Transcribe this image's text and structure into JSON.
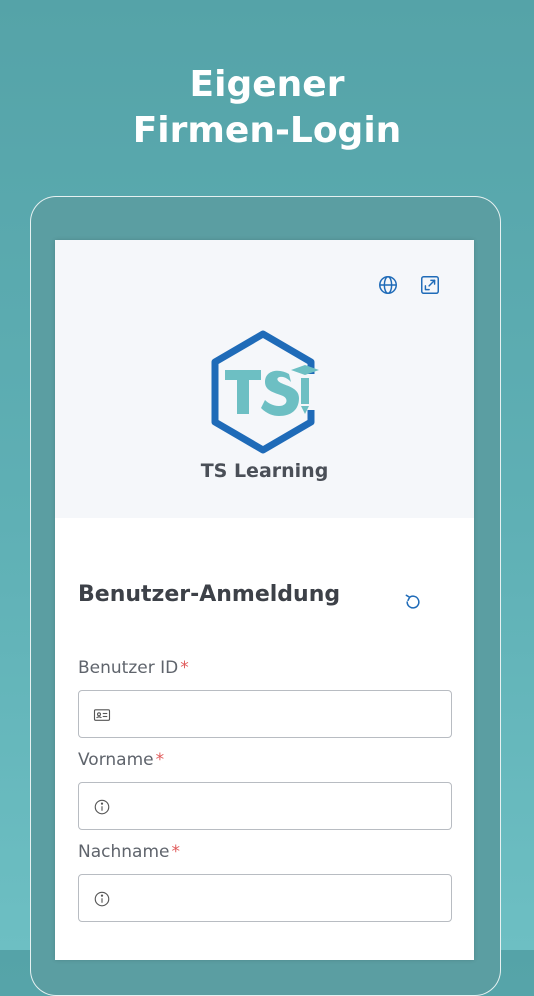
{
  "headline": {
    "line1": "Eigener",
    "line2": "Firmen-Login"
  },
  "brand": {
    "name": "TS Learning",
    "primary_color": "#1f6bb8",
    "accent_color": "#6dbfc3"
  },
  "toolbar": {
    "language_icon": "globe-icon",
    "expand_icon": "expand-icon"
  },
  "form": {
    "title": "Benutzer-Anmeldung",
    "refresh_icon": "refresh-icon",
    "fields": [
      {
        "label": "Benutzer ID",
        "required_mark": "*",
        "icon": "id-card-icon",
        "value": "",
        "placeholder": ""
      },
      {
        "label": "Vorname",
        "required_mark": "*",
        "icon": "info-icon",
        "value": "",
        "placeholder": ""
      },
      {
        "label": "Nachname",
        "required_mark": "*",
        "icon": "info-icon",
        "value": "",
        "placeholder": ""
      }
    ]
  }
}
